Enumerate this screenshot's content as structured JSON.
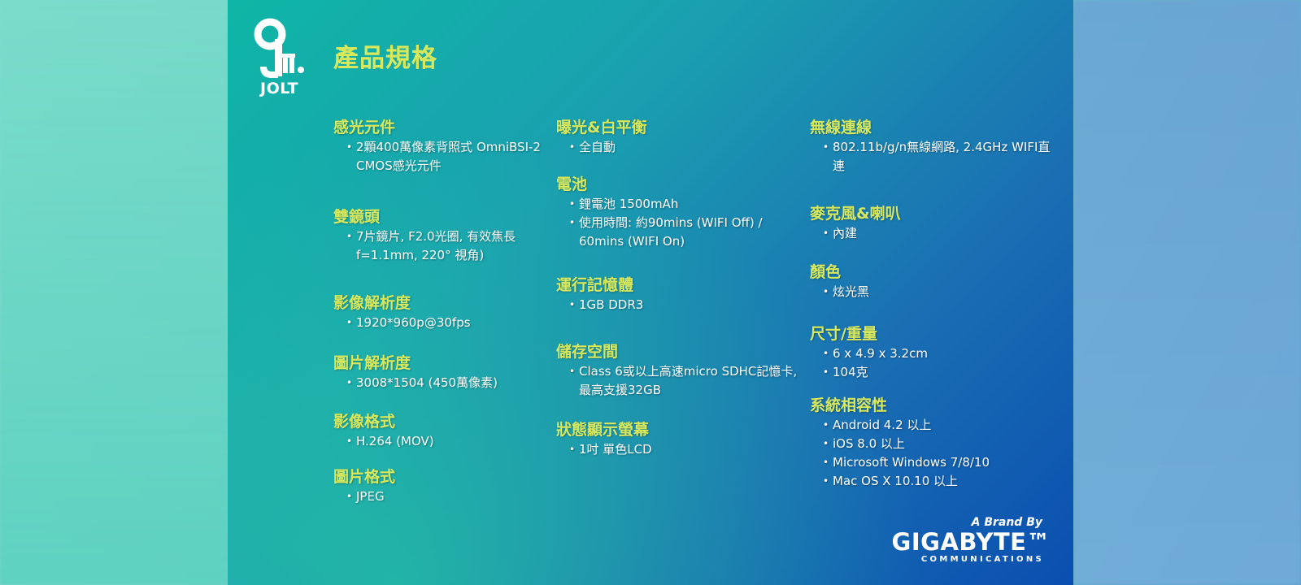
{
  "header": {
    "title": "產品規格",
    "logo_text": "JOLT"
  },
  "columns": [
    [
      {
        "title": "感光元件",
        "items": [
          "2顆400萬像素背照式 OmniBSI-2 CMOS感光元件"
        ]
      },
      {
        "title": "雙鏡頭",
        "items": [
          "7片鏡片, F2.0光圈, 有效焦長 f=1.1mm, 220° 視角)"
        ]
      },
      {
        "title": "影像解析度",
        "items": [
          "1920*960p@30fps"
        ]
      },
      {
        "title": "圖片解析度",
        "items": [
          "3008*1504 (450萬像素)"
        ]
      },
      {
        "title": "影像格式",
        "items": [
          "H.264 (MOV)"
        ]
      },
      {
        "title": "圖片格式",
        "items": [
          "JPEG"
        ]
      }
    ],
    [
      {
        "title": "曝光&白平衡",
        "items": [
          "全自動"
        ]
      },
      {
        "title": "電池",
        "items": [
          "鋰電池 1500mAh",
          "使用時間: 約90mins (WIFI Off) / 60mins (WIFI On)"
        ]
      },
      {
        "title": "運行記憶體",
        "items": [
          "1GB DDR3"
        ]
      },
      {
        "title": "儲存空間",
        "items": [
          "Class 6或以上高速micro SDHC記憶卡, 最高支援32GB"
        ]
      },
      {
        "title": "狀態顯示螢幕",
        "items": [
          "1吋 單色LCD"
        ]
      }
    ],
    [
      {
        "title": "無線連線",
        "items": [
          "802.11b/g/n無線網路, 2.4GHz WIFI直連"
        ]
      },
      {
        "title": "麥克風&喇叭",
        "items": [
          "內建"
        ]
      },
      {
        "title": "顏色",
        "items": [
          "炫光黑"
        ]
      },
      {
        "title": "尺寸/重量",
        "items": [
          "6 x 4.9  x 3.2cm",
          "104克"
        ]
      },
      {
        "title": "系統相容性",
        "items": [
          "Android 4.2 以上",
          "iOS 8.0 以上",
          "Microsoft Windows 7/8/10",
          "Mac OS X 10.10 以上"
        ]
      }
    ]
  ],
  "brand": {
    "prefix": "A Brand By",
    "name": "GIGABYTE™",
    "sub": "COMMUNICATIONS"
  },
  "colors": {
    "heading": "#d8e85a",
    "text": "#ffffff"
  }
}
